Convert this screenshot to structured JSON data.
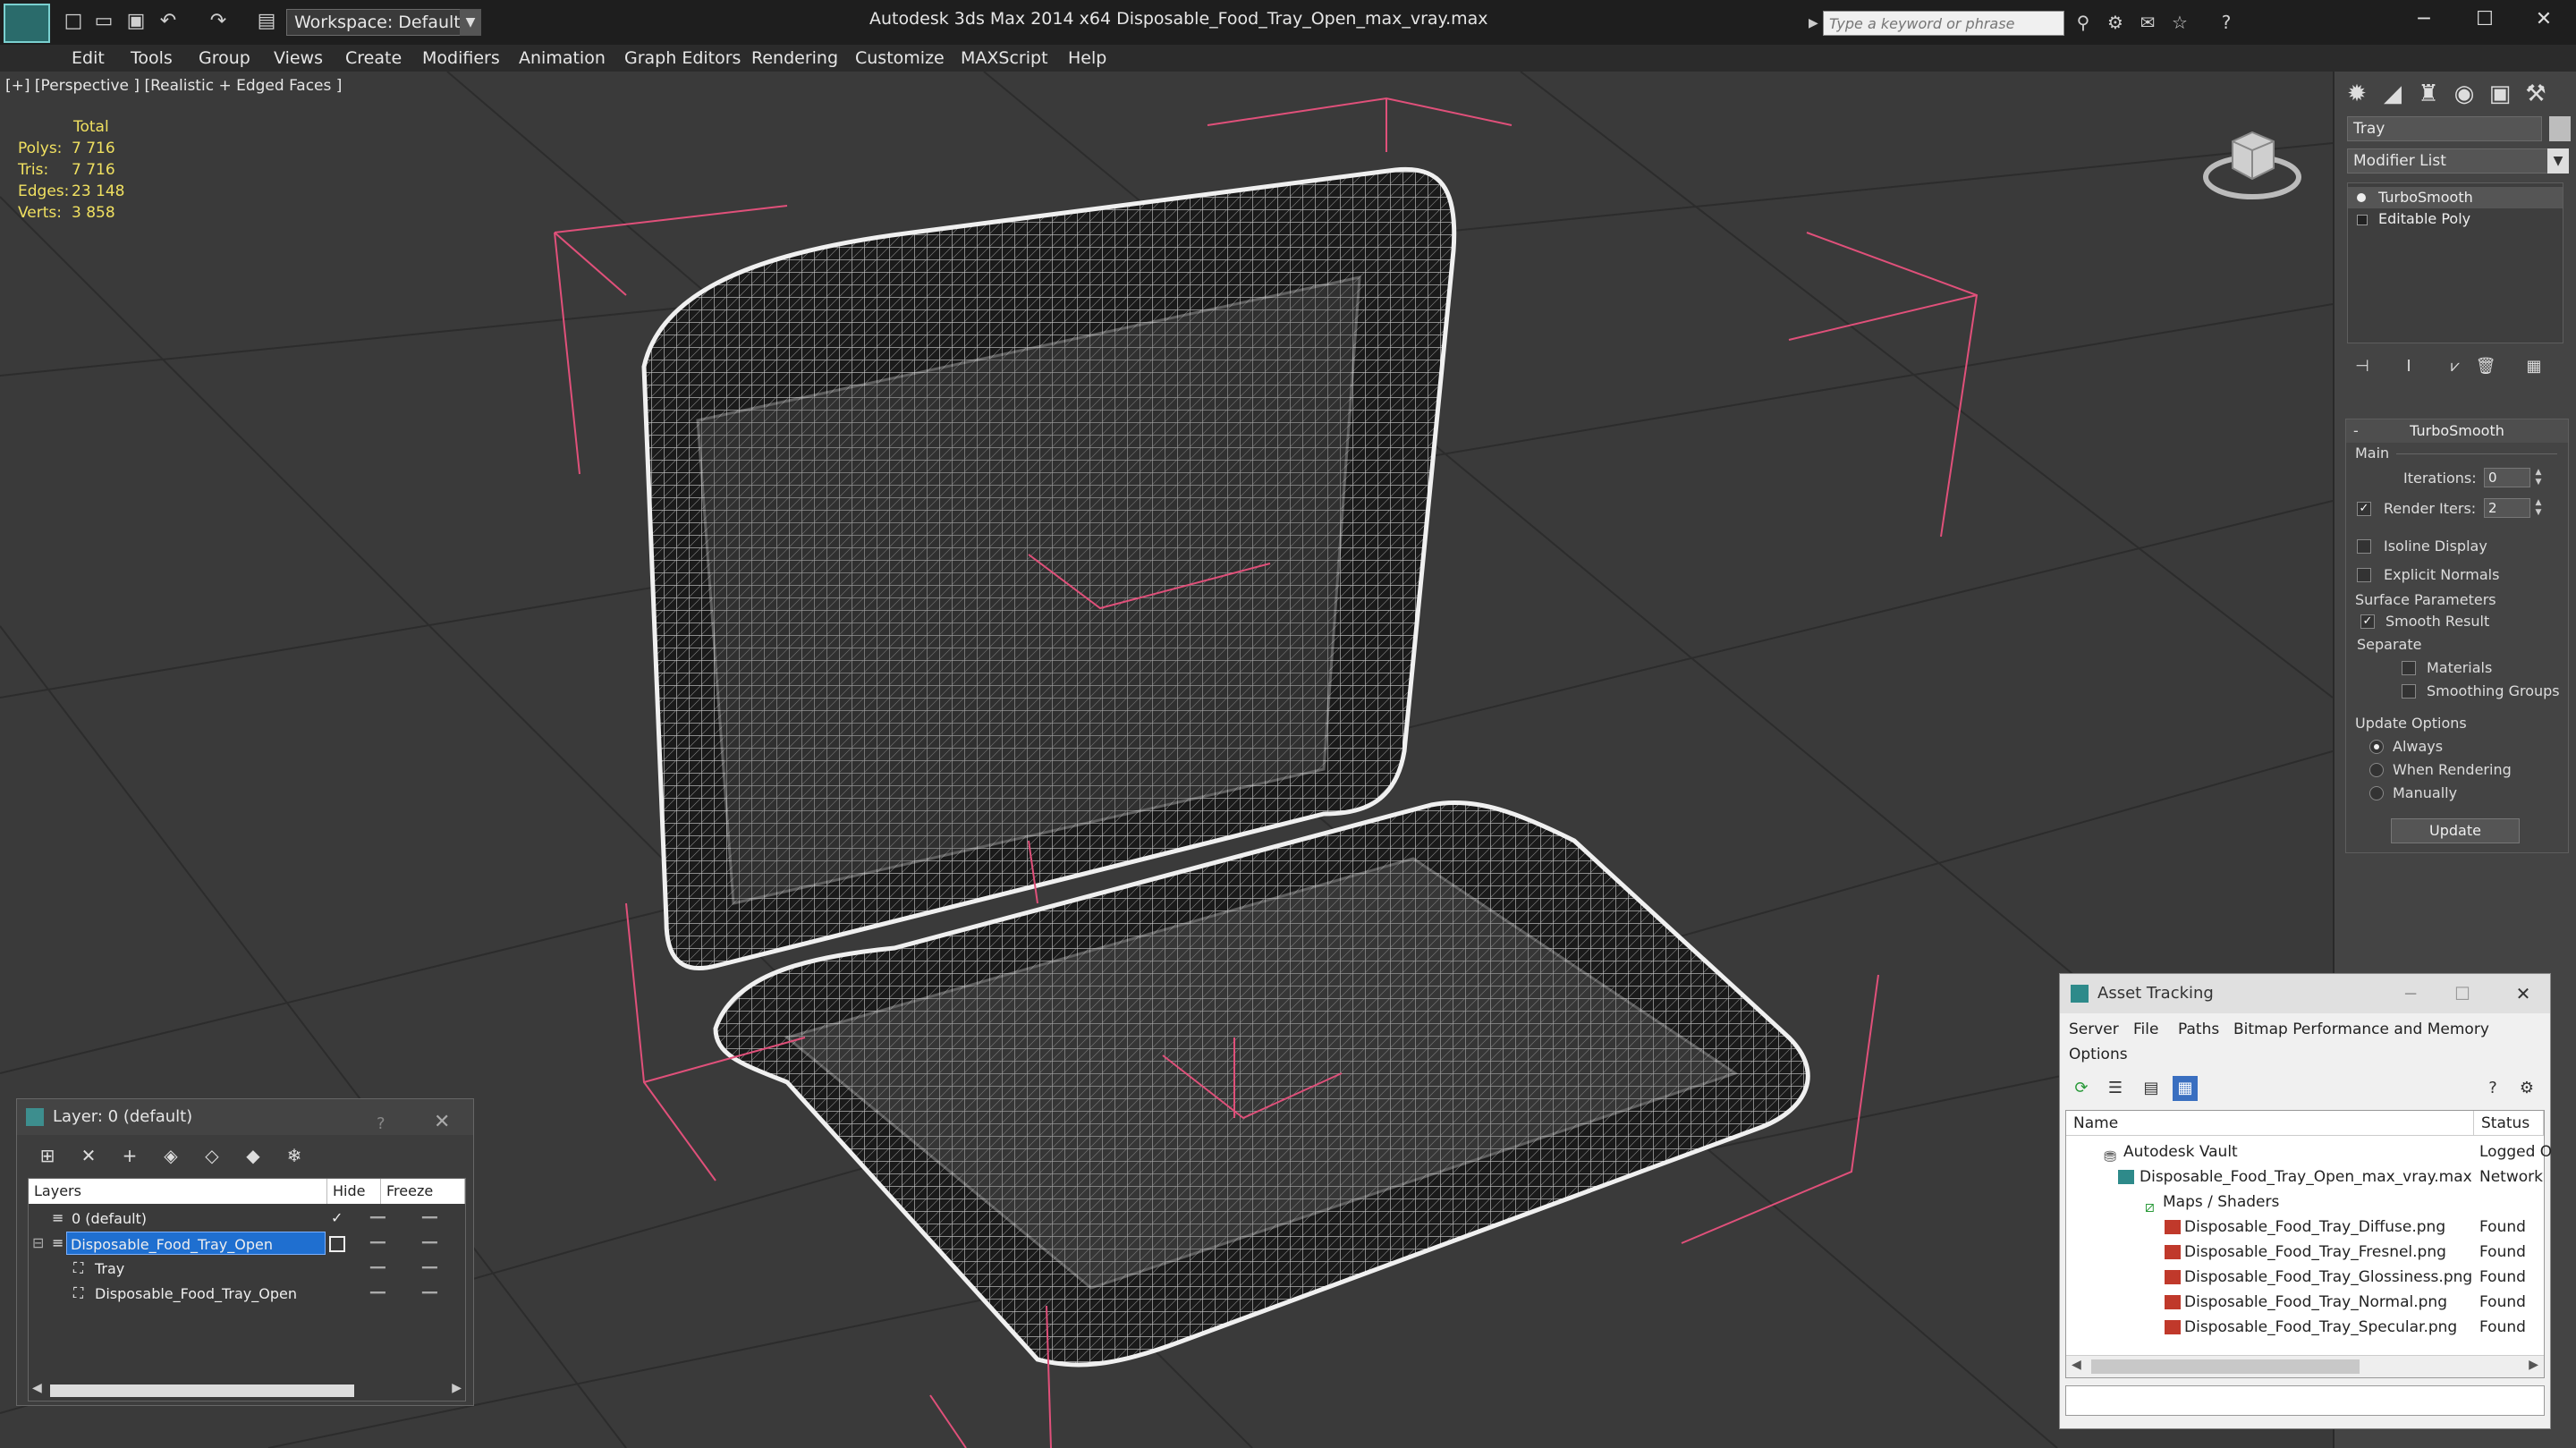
{
  "window": {
    "title": "Autodesk 3ds Max  2014 x64      Disposable_Food_Tray_Open_max_vray.max",
    "workspace": "Workspace: Default",
    "search_placeholder": "Type a keyword or phrase"
  },
  "menu": [
    "Edit",
    "Tools",
    "Group",
    "Views",
    "Create",
    "Modifiers",
    "Animation",
    "Graph Editors",
    "Rendering",
    "Customize",
    "MAXScript",
    "Help"
  ],
  "viewport": {
    "label": "[+] [Perspective ] [Realistic + Edged Faces ]",
    "stats": {
      "header": "Total",
      "rows": [
        {
          "label": "Polys:",
          "value": "7 716"
        },
        {
          "label": "Tris:",
          "value": "7 716"
        },
        {
          "label": "Edges:",
          "value": "23 148"
        },
        {
          "label": "Verts:",
          "value": "3 858"
        }
      ]
    }
  },
  "command_panel": {
    "object_name": "Tray",
    "modifier_list": "Modifier List",
    "stack": [
      "TurboSmooth",
      "Editable Poly"
    ],
    "rollout": {
      "title": "TurboSmooth",
      "main_label": "Main",
      "iterations_label": "Iterations:",
      "iterations_value": "0",
      "render_iters_label": "Render Iters:",
      "render_iters_value": "2",
      "isoline": "Isoline Display",
      "explicit_normals": "Explicit Normals",
      "surface_label": "Surface Parameters",
      "smooth_result": "Smooth Result",
      "separate_label": "Separate",
      "materials": "Materials",
      "smoothing_groups": "Smoothing Groups",
      "update_options_label": "Update Options",
      "always": "Always",
      "when_rendering": "When Rendering",
      "manually": "Manually",
      "update_button": "Update"
    }
  },
  "layer_window": {
    "title": "Layer: 0 (default)",
    "question": "?",
    "columns": [
      "Layers",
      "Hide",
      "Freeze"
    ],
    "rows": [
      {
        "name": "0 (default)"
      },
      {
        "name": "Disposable_Food_Tray_Open"
      },
      {
        "name": "Tray"
      },
      {
        "name": "Disposable_Food_Tray_Open"
      }
    ]
  },
  "asset_window": {
    "title": "Asset Tracking",
    "menu": [
      "Server",
      "File",
      "Paths",
      "Bitmap Performance and Memory",
      "Options"
    ],
    "columns": [
      "Name",
      "Status"
    ],
    "rows": [
      {
        "name": "Autodesk Vault",
        "status": "Logged O"
      },
      {
        "name": "Disposable_Food_Tray_Open_max_vray.max",
        "status": "Network"
      },
      {
        "name": "Maps / Shaders",
        "status": ""
      },
      {
        "name": "Disposable_Food_Tray_Diffuse.png",
        "status": "Found"
      },
      {
        "name": "Disposable_Food_Tray_Fresnel.png",
        "status": "Found"
      },
      {
        "name": "Disposable_Food_Tray_Glossiness.png",
        "status": "Found"
      },
      {
        "name": "Disposable_Food_Tray_Normal.png",
        "status": "Found"
      },
      {
        "name": "Disposable_Food_Tray_Specular.png",
        "status": "Found"
      }
    ]
  },
  "colors": {
    "stats_yellow": "#f0e060",
    "selection_blue": "#1f6fd0",
    "gizmo_pink": "#e0507a"
  }
}
